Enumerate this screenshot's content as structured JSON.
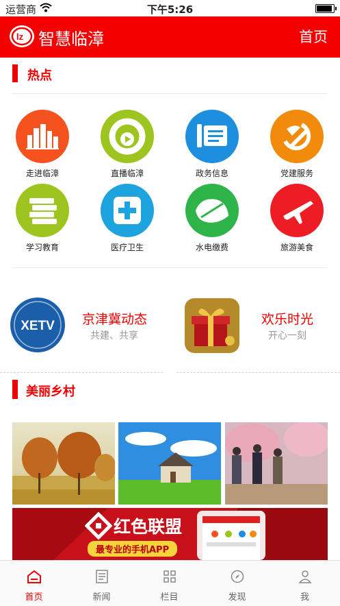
{
  "status": {
    "carrier": "运营商",
    "time": "下午5:26"
  },
  "header": {
    "app_name": "智慧临漳",
    "home": "首页"
  },
  "hot": {
    "title": "热点",
    "items": [
      {
        "label": "走进临漳",
        "icon": "city-icon",
        "color": "#f5521f"
      },
      {
        "label": "直播临漳",
        "icon": "live-play-icon",
        "color": "#9dc41f"
      },
      {
        "label": "政务信息",
        "icon": "document-pen-icon",
        "color": "#1d8fde"
      },
      {
        "label": "党建服务",
        "icon": "party-emblem-icon",
        "color": "#f28a0c"
      },
      {
        "label": "学习教育",
        "icon": "books-icon",
        "color": "#9dc41f"
      },
      {
        "label": "医疗卫生",
        "icon": "medical-cross-icon",
        "color": "#1da3de"
      },
      {
        "label": "水电缴费",
        "icon": "leaf-icon",
        "color": "#2fb44a"
      },
      {
        "label": "旅游美食",
        "icon": "airplane-icon",
        "color": "#ee1c24"
      }
    ]
  },
  "promos": [
    {
      "title": "京津冀动态",
      "subtitle": "共建、共享",
      "icon": "xetv-logo",
      "logo_text": "XETV"
    },
    {
      "title": "欢乐时光",
      "subtitle": "开心一刻",
      "icon": "gift-box-image"
    }
  ],
  "village": {
    "title": "美丽乡村"
  },
  "banner": {
    "title": "红色联盟",
    "subtitle": "最专业的手机APP",
    "logo_text": "SS"
  },
  "tabs": [
    {
      "label": "首页",
      "icon": "home-icon",
      "active": true
    },
    {
      "label": "新闻",
      "icon": "news-icon",
      "active": false
    },
    {
      "label": "栏目",
      "icon": "grid-icon",
      "active": false
    },
    {
      "label": "发现",
      "icon": "compass-icon",
      "active": false
    },
    {
      "label": "我",
      "icon": "person-icon",
      "active": false
    }
  ],
  "colors": {
    "brand_red": "#f40000",
    "accent_red": "#ee0000"
  }
}
